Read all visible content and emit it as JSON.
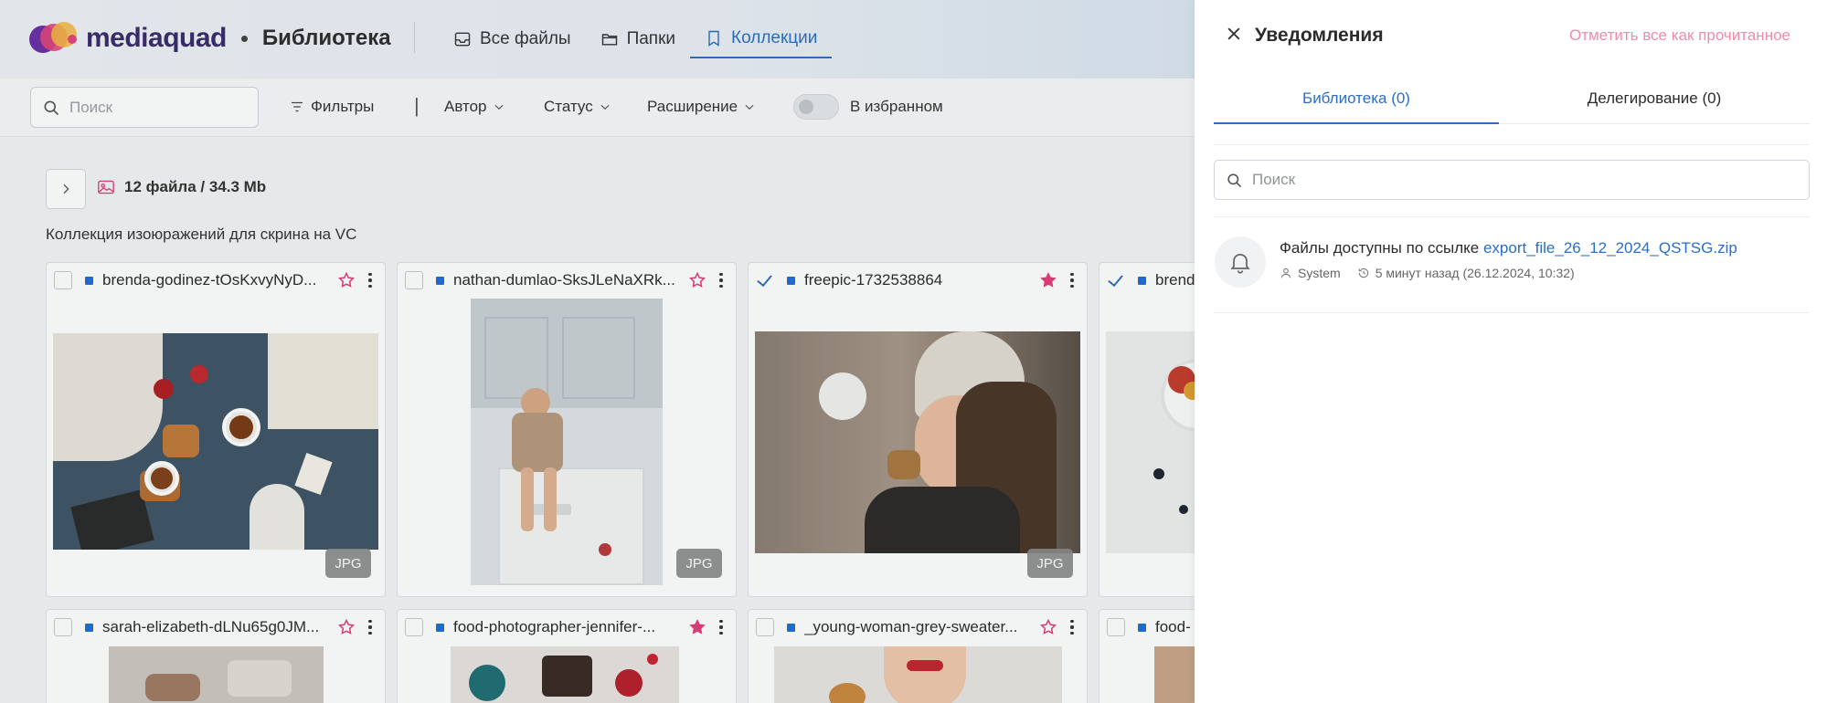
{
  "header": {
    "brand": "mediaquad",
    "section": "Библиотека",
    "nav": [
      {
        "label": "Все файлы",
        "icon": "inbox-icon"
      },
      {
        "label": "Папки",
        "icon": "folder-icon"
      },
      {
        "label": "Коллекции",
        "icon": "bookmark-icon",
        "active": true
      }
    ]
  },
  "toolbar": {
    "search_placeholder": "Поиск",
    "filters_label": "Фильтры",
    "author_label": "Автор",
    "status_label": "Статус",
    "extension_label": "Расширение",
    "favorites_label": "В избранном"
  },
  "collection": {
    "files_count": "12 файла / 34.3 Mb",
    "description": "Коллекция изоюражений для скрина на VC"
  },
  "cards": [
    {
      "name": "brenda-godinez-tOsKxvyNyD...",
      "favorite": false,
      "selected": false,
      "badge": "JPG"
    },
    {
      "name": "nathan-dumlao-SksJLeNaXRk...",
      "favorite": false,
      "selected": false,
      "badge": "JPG"
    },
    {
      "name": "freepic-1732538864",
      "favorite": true,
      "selected": true,
      "badge": "JPG"
    },
    {
      "name": "brend",
      "favorite": false,
      "selected": true,
      "badge": ""
    },
    {
      "name": "sarah-elizabeth-dLNu65g0JM...",
      "favorite": false,
      "selected": false
    },
    {
      "name": "food-photographer-jennifer-...",
      "favorite": true,
      "selected": false
    },
    {
      "name": "_young-woman-grey-sweater...",
      "favorite": false,
      "selected": false
    },
    {
      "name": "food-",
      "favorite": false,
      "selected": false
    }
  ],
  "notifications": {
    "title": "Уведомления",
    "mark_all": "Отметить все как прочитанное",
    "tabs": [
      {
        "label": "Библиотека (0)",
        "active": true
      },
      {
        "label": "Делегирование (0)",
        "active": false
      }
    ],
    "search_placeholder": "Поиск",
    "items": [
      {
        "text": "Файлы доступны по ссылке ",
        "link": "export_file_26_12_2024_QSTSG.zip",
        "author": "System",
        "time": "5 минут назад (26.12.2024, 10:32)"
      }
    ]
  },
  "colors": {
    "accent": "#2a6fc6",
    "favorite": "#e23d7a",
    "mark_all": "#f28aa8",
    "badge": "#8a8a8a"
  }
}
